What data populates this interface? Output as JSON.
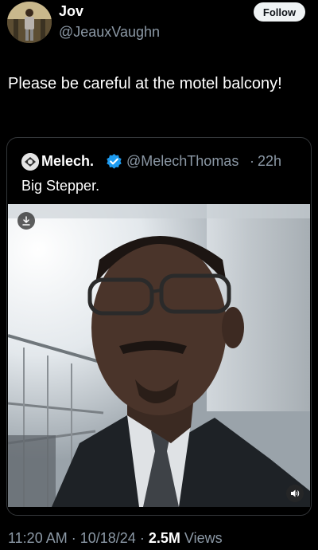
{
  "author": {
    "display_name": "Jov",
    "handle": "@JeauxVaughn",
    "follow_label": "Follow"
  },
  "tweet": {
    "text": "Please be careful at the motel balcony!"
  },
  "quoted": {
    "display_name": "Melech.",
    "handle": "@MelechThomas",
    "separator": "·",
    "time": "22h",
    "text": "Big Stepper.",
    "verified_color": "#1d9bf0"
  },
  "meta": {
    "time": "11:20 AM",
    "sep1": "·",
    "date": "10/18/24",
    "sep2": "·",
    "views_count": "2.5M",
    "views_label": "Views"
  },
  "icons": {
    "download": "download-icon",
    "volume": "volume-icon",
    "verified": "verified-badge-icon"
  }
}
